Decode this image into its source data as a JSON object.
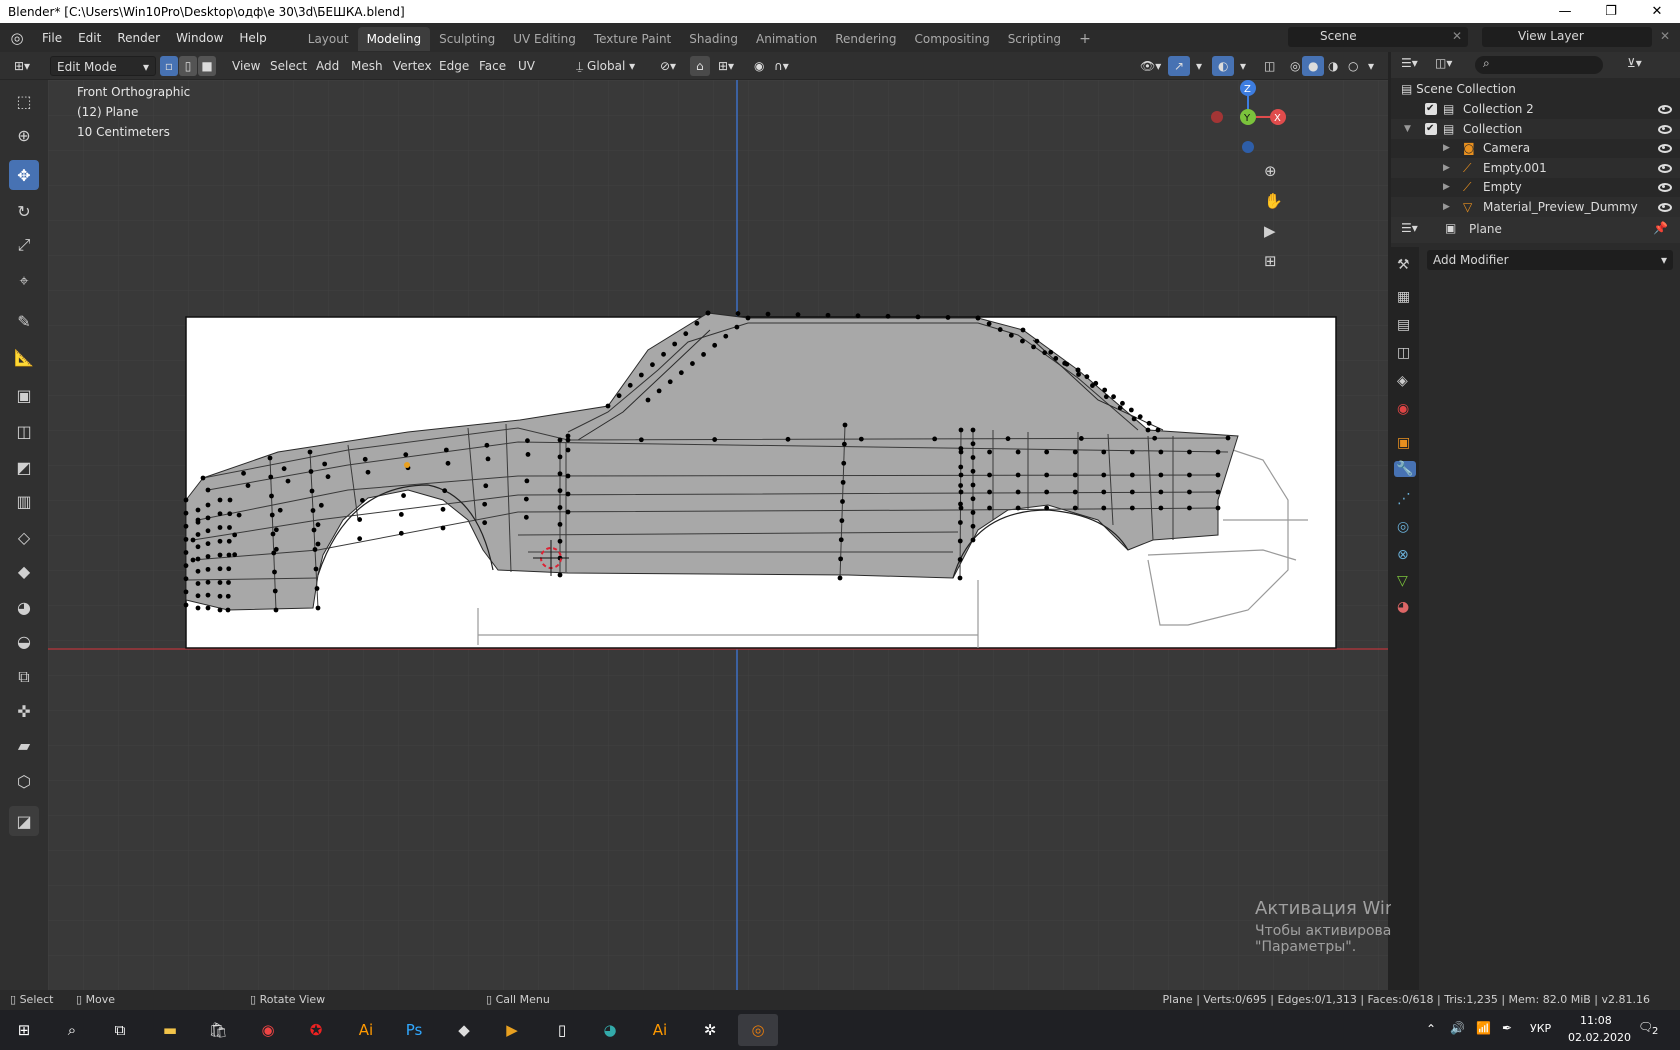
{
  "titlebar": {
    "title": "Blender* [C:\\Users\\Win10Pro\\Desktop\\одф\\е 30\\3d\\БЕШКА.blend]",
    "minimize": "—",
    "restore": "❐",
    "close": "✕"
  },
  "menus": [
    "File",
    "Edit",
    "Render",
    "Window",
    "Help"
  ],
  "workspaces": [
    "Layout",
    "Modeling",
    "Sculpting",
    "UV Editing",
    "Texture Paint",
    "Shading",
    "Animation",
    "Rendering",
    "Compositing",
    "Scripting"
  ],
  "active_workspace": "Modeling",
  "scene": {
    "label": "Scene",
    "view_layer": "View Layer"
  },
  "header": {
    "mode": "Edit Mode",
    "menus": [
      "View",
      "Select",
      "Add",
      "Mesh",
      "Vertex",
      "Edge",
      "Face",
      "UV"
    ],
    "orientation": "Global"
  },
  "viewport": {
    "view": "Front Orthographic",
    "object": "(12) Plane",
    "scale": "10 Centimeters",
    "gizmo": {
      "z": "Z",
      "y": "Y",
      "x": "X"
    }
  },
  "outliner": {
    "root": "Scene Collection",
    "items": [
      {
        "label": "Collection 2",
        "depth": 1,
        "icon": "collection-icon"
      },
      {
        "label": "Collection",
        "depth": 1,
        "icon": "collection-icon"
      },
      {
        "label": "Camera",
        "depth": 2,
        "icon": "camera-icon"
      },
      {
        "label": "Empty.001",
        "depth": 2,
        "icon": "empty-icon"
      },
      {
        "label": "Empty",
        "depth": 2,
        "icon": "empty-icon"
      },
      {
        "label": "Material_Preview_Dummy",
        "depth": 2,
        "icon": "mesh-icon"
      }
    ]
  },
  "properties": {
    "object": "Plane",
    "add_modifier": "Add Modifier"
  },
  "status": {
    "select": "Select",
    "move": "Move",
    "rotate": "Rotate View",
    "menu": "Call Menu",
    "stats": "Plane | Verts:0/695 | Edges:0/1,313 | Faces:0/618 | Tris:1,235 | Mem: 82.0 MiB | v2.81.16"
  },
  "watermark": {
    "title": "Активация Windows",
    "line1": "Чтобы активировать Windows, перейдите в раздел",
    "line2": "\"Параметры\"."
  },
  "taskbar": {
    "lang": "УКР",
    "time": "11:08",
    "date": "02.02.2020",
    "notif": "2"
  },
  "colors": {
    "accent": "#4772b3",
    "x_axis": "#e04c4c",
    "y_axis": "#7bc33c",
    "z_axis": "#3d7de0"
  }
}
